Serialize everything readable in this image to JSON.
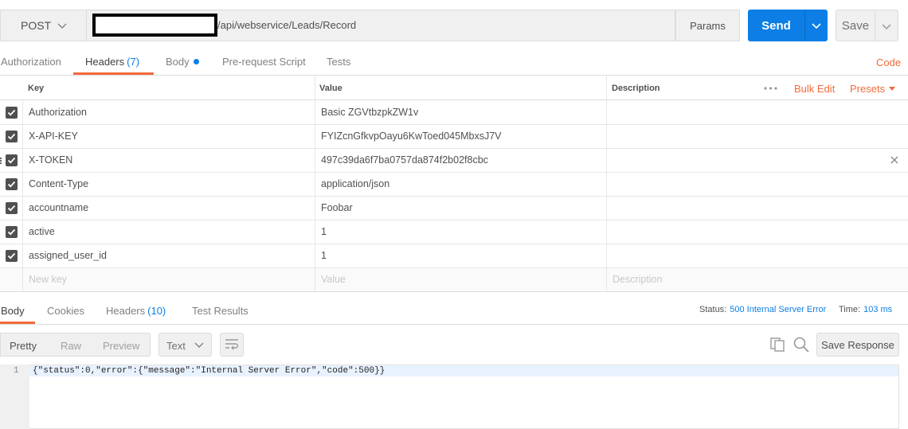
{
  "request": {
    "method": "POST",
    "url_suffix": "/api/webservice/Leads/Record",
    "params_label": "Params",
    "send_label": "Send",
    "save_label": "Save"
  },
  "request_tabs": {
    "items": [
      {
        "label": "Authorization",
        "count": ""
      },
      {
        "label": "Headers",
        "count": "(7)"
      },
      {
        "label": "Body",
        "count": ""
      },
      {
        "label": "Pre-request Script",
        "count": ""
      },
      {
        "label": "Tests",
        "count": ""
      }
    ],
    "active": "Headers",
    "code_label": "Code"
  },
  "headers_table": {
    "columns": {
      "key": "Key",
      "value": "Value",
      "description": "Description"
    },
    "bulk_edit_label": "Bulk Edit",
    "presets_label": "Presets",
    "rows": [
      {
        "key": "Authorization",
        "value": "Basic ZGVtbzpkZW1v",
        "checked": true
      },
      {
        "key": "X-API-KEY",
        "value": "FYIZcnGfkvpOayu6KwToed045MbxsJ7V",
        "checked": true
      },
      {
        "key": "X-TOKEN",
        "value": "497c39da6f7ba0757da874f2b02f8cbc",
        "checked": true
      },
      {
        "key": "Content-Type",
        "value": "application/json",
        "checked": true
      },
      {
        "key": "accountname",
        "value": "Foobar",
        "checked": true
      },
      {
        "key": "active",
        "value": "1",
        "checked": true
      },
      {
        "key": "assigned_user_id",
        "value": "1",
        "checked": true
      }
    ],
    "new_row": {
      "key_placeholder": "New key",
      "value_placeholder": "Value",
      "description_placeholder": "Description"
    }
  },
  "response": {
    "tabs": [
      {
        "label": "Body",
        "count": ""
      },
      {
        "label": "Cookies",
        "count": ""
      },
      {
        "label": "Headers",
        "count": "(10)"
      },
      {
        "label": "Test Results",
        "count": ""
      }
    ],
    "status_label": "Status:",
    "status_value": "500 Internal Server Error",
    "time_label": "Time:",
    "time_value": "103 ms",
    "view_options": [
      "Pretty",
      "Raw",
      "Preview"
    ],
    "active_view": "Pretty",
    "format": "Text",
    "save_response_label": "Save Response",
    "lines": [
      {
        "no": "1",
        "text": "{\"status\":0,\"error\":{\"message\":\"Internal Server Error\",\"code\":500}}"
      }
    ]
  },
  "colors": {
    "accent": "#f26b3a",
    "primary": "#0c7ee6"
  },
  "icons": [
    "chevron-down-icon",
    "check-icon",
    "close-icon",
    "more-dots-icon",
    "caret-down-icon",
    "wrap-icon",
    "copy-icon",
    "search-icon"
  ]
}
